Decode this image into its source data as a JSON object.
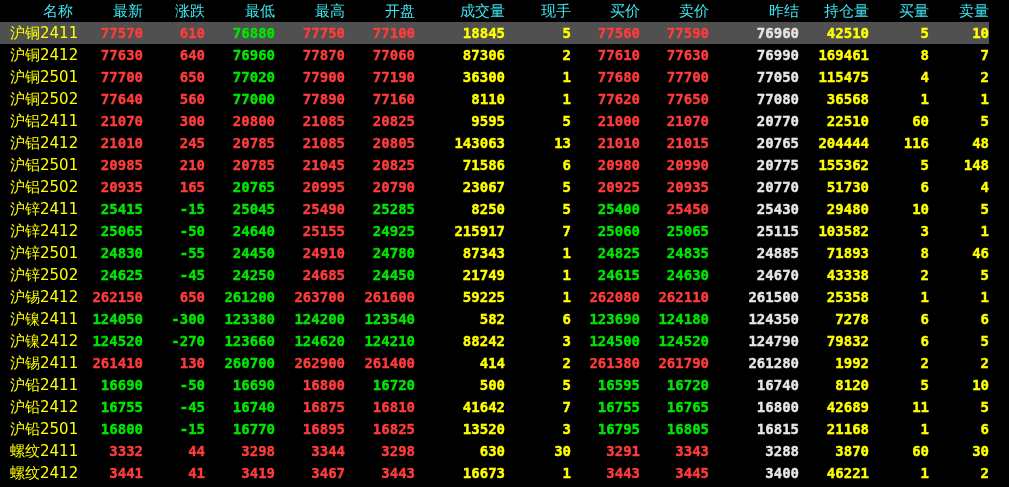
{
  "columns": [
    "名称",
    "最新",
    "涨跌",
    "最低",
    "最高",
    "开盘",
    "成交量",
    "现手",
    "买价",
    "卖价",
    "昨结",
    "持仓量",
    "买量",
    "卖量"
  ],
  "rows": [
    {
      "selected": true,
      "name": "沪铜2411",
      "cells": [
        {
          "text": "77570",
          "color": "#ff3c3c"
        },
        {
          "text": "610",
          "color": "#ff3c3c"
        },
        {
          "text": "76880",
          "color": "#00e600"
        },
        {
          "text": "77750",
          "color": "#ff3c3c"
        },
        {
          "text": "77100",
          "color": "#ff3c3c"
        },
        {
          "text": "18845"
        },
        {
          "text": "5"
        },
        {
          "text": "77560",
          "color": "#ff3c3c"
        },
        {
          "text": "77590",
          "color": "#ff3c3c"
        },
        {
          "text": "76960"
        },
        {
          "text": "42510"
        },
        {
          "text": "5"
        },
        {
          "text": "10"
        }
      ]
    },
    {
      "selected": false,
      "name": "沪铜2412",
      "cells": [
        {
          "text": "77630",
          "color": "#ff3c3c"
        },
        {
          "text": "640",
          "color": "#ff3c3c"
        },
        {
          "text": "76960",
          "color": "#00e600"
        },
        {
          "text": "77870",
          "color": "#ff3c3c"
        },
        {
          "text": "77060",
          "color": "#ff3c3c"
        },
        {
          "text": "87306"
        },
        {
          "text": "2"
        },
        {
          "text": "77610",
          "color": "#ff3c3c"
        },
        {
          "text": "77630",
          "color": "#ff3c3c"
        },
        {
          "text": "76990"
        },
        {
          "text": "169461"
        },
        {
          "text": "8"
        },
        {
          "text": "7"
        }
      ]
    },
    {
      "selected": false,
      "name": "沪铜2501",
      "cells": [
        {
          "text": "77700",
          "color": "#ff3c3c"
        },
        {
          "text": "650",
          "color": "#ff3c3c"
        },
        {
          "text": "77020",
          "color": "#00e600"
        },
        {
          "text": "77900",
          "color": "#ff3c3c"
        },
        {
          "text": "77190",
          "color": "#ff3c3c"
        },
        {
          "text": "36300"
        },
        {
          "text": "1"
        },
        {
          "text": "77680",
          "color": "#ff3c3c"
        },
        {
          "text": "77700",
          "color": "#ff3c3c"
        },
        {
          "text": "77050"
        },
        {
          "text": "115475"
        },
        {
          "text": "4"
        },
        {
          "text": "2"
        }
      ]
    },
    {
      "selected": false,
      "name": "沪铜2502",
      "cells": [
        {
          "text": "77640",
          "color": "#ff3c3c"
        },
        {
          "text": "560",
          "color": "#ff3c3c"
        },
        {
          "text": "77000",
          "color": "#00e600"
        },
        {
          "text": "77890",
          "color": "#ff3c3c"
        },
        {
          "text": "77160",
          "color": "#ff3c3c"
        },
        {
          "text": "8110"
        },
        {
          "text": "1"
        },
        {
          "text": "77620",
          "color": "#ff3c3c"
        },
        {
          "text": "77650",
          "color": "#ff3c3c"
        },
        {
          "text": "77080"
        },
        {
          "text": "36568"
        },
        {
          "text": "1"
        },
        {
          "text": "1"
        }
      ]
    },
    {
      "selected": false,
      "name": "沪铝2411",
      "cells": [
        {
          "text": "21070",
          "color": "#ff3c3c"
        },
        {
          "text": "300",
          "color": "#ff3c3c"
        },
        {
          "text": "20800",
          "color": "#ff3c3c"
        },
        {
          "text": "21085",
          "color": "#ff3c3c"
        },
        {
          "text": "20825",
          "color": "#ff3c3c"
        },
        {
          "text": "9595"
        },
        {
          "text": "5"
        },
        {
          "text": "21000",
          "color": "#ff3c3c"
        },
        {
          "text": "21070",
          "color": "#ff3c3c"
        },
        {
          "text": "20770"
        },
        {
          "text": "22510"
        },
        {
          "text": "60"
        },
        {
          "text": "5"
        }
      ]
    },
    {
      "selected": false,
      "name": "沪铝2412",
      "cells": [
        {
          "text": "21010",
          "color": "#ff3c3c"
        },
        {
          "text": "245",
          "color": "#ff3c3c"
        },
        {
          "text": "20785",
          "color": "#ff3c3c"
        },
        {
          "text": "21085",
          "color": "#ff3c3c"
        },
        {
          "text": "20805",
          "color": "#ff3c3c"
        },
        {
          "text": "143063"
        },
        {
          "text": "13"
        },
        {
          "text": "21010",
          "color": "#ff3c3c"
        },
        {
          "text": "21015",
          "color": "#ff3c3c"
        },
        {
          "text": "20765"
        },
        {
          "text": "204444"
        },
        {
          "text": "116"
        },
        {
          "text": "48"
        }
      ]
    },
    {
      "selected": false,
      "name": "沪铝2501",
      "cells": [
        {
          "text": "20985",
          "color": "#ff3c3c"
        },
        {
          "text": "210",
          "color": "#ff3c3c"
        },
        {
          "text": "20785",
          "color": "#ff3c3c"
        },
        {
          "text": "21045",
          "color": "#ff3c3c"
        },
        {
          "text": "20825",
          "color": "#ff3c3c"
        },
        {
          "text": "71586"
        },
        {
          "text": "6"
        },
        {
          "text": "20980",
          "color": "#ff3c3c"
        },
        {
          "text": "20990",
          "color": "#ff3c3c"
        },
        {
          "text": "20775"
        },
        {
          "text": "155362"
        },
        {
          "text": "5"
        },
        {
          "text": "148"
        }
      ]
    },
    {
      "selected": false,
      "name": "沪铝2502",
      "cells": [
        {
          "text": "20935",
          "color": "#ff3c3c"
        },
        {
          "text": "165",
          "color": "#ff3c3c"
        },
        {
          "text": "20765",
          "color": "#00e600"
        },
        {
          "text": "20995",
          "color": "#ff3c3c"
        },
        {
          "text": "20790",
          "color": "#ff3c3c"
        },
        {
          "text": "23067"
        },
        {
          "text": "5"
        },
        {
          "text": "20925",
          "color": "#ff3c3c"
        },
        {
          "text": "20935",
          "color": "#ff3c3c"
        },
        {
          "text": "20770"
        },
        {
          "text": "51730"
        },
        {
          "text": "6"
        },
        {
          "text": "4"
        }
      ]
    },
    {
      "selected": false,
      "name": "沪锌2411",
      "cells": [
        {
          "text": "25415",
          "color": "#00e600"
        },
        {
          "text": "-15",
          "color": "#00e600"
        },
        {
          "text": "25045",
          "color": "#00e600"
        },
        {
          "text": "25490",
          "color": "#ff3c3c"
        },
        {
          "text": "25285",
          "color": "#00e600"
        },
        {
          "text": "8250"
        },
        {
          "text": "5"
        },
        {
          "text": "25400",
          "color": "#00e600"
        },
        {
          "text": "25450",
          "color": "#ff3c3c"
        },
        {
          "text": "25430"
        },
        {
          "text": "29480"
        },
        {
          "text": "10"
        },
        {
          "text": "5"
        }
      ]
    },
    {
      "selected": false,
      "name": "沪锌2412",
      "cells": [
        {
          "text": "25065",
          "color": "#00e600"
        },
        {
          "text": "-50",
          "color": "#00e600"
        },
        {
          "text": "24640",
          "color": "#00e600"
        },
        {
          "text": "25155",
          "color": "#ff3c3c"
        },
        {
          "text": "24925",
          "color": "#00e600"
        },
        {
          "text": "215917"
        },
        {
          "text": "7"
        },
        {
          "text": "25060",
          "color": "#00e600"
        },
        {
          "text": "25065",
          "color": "#00e600"
        },
        {
          "text": "25115"
        },
        {
          "text": "103582"
        },
        {
          "text": "3"
        },
        {
          "text": "1"
        }
      ]
    },
    {
      "selected": false,
      "name": "沪锌2501",
      "cells": [
        {
          "text": "24830",
          "color": "#00e600"
        },
        {
          "text": "-55",
          "color": "#00e600"
        },
        {
          "text": "24450",
          "color": "#00e600"
        },
        {
          "text": "24910",
          "color": "#ff3c3c"
        },
        {
          "text": "24780",
          "color": "#00e600"
        },
        {
          "text": "87343"
        },
        {
          "text": "1"
        },
        {
          "text": "24825",
          "color": "#00e600"
        },
        {
          "text": "24835",
          "color": "#00e600"
        },
        {
          "text": "24885"
        },
        {
          "text": "71893"
        },
        {
          "text": "8"
        },
        {
          "text": "46"
        }
      ]
    },
    {
      "selected": false,
      "name": "沪锌2502",
      "cells": [
        {
          "text": "24625",
          "color": "#00e600"
        },
        {
          "text": "-45",
          "color": "#00e600"
        },
        {
          "text": "24250",
          "color": "#00e600"
        },
        {
          "text": "24685",
          "color": "#ff3c3c"
        },
        {
          "text": "24450",
          "color": "#00e600"
        },
        {
          "text": "21749"
        },
        {
          "text": "1"
        },
        {
          "text": "24615",
          "color": "#00e600"
        },
        {
          "text": "24630",
          "color": "#00e600"
        },
        {
          "text": "24670"
        },
        {
          "text": "43338"
        },
        {
          "text": "2"
        },
        {
          "text": "5"
        }
      ]
    },
    {
      "selected": false,
      "name": "沪锡2412",
      "cells": [
        {
          "text": "262150",
          "color": "#ff3c3c"
        },
        {
          "text": "650",
          "color": "#ff3c3c"
        },
        {
          "text": "261200",
          "color": "#00e600"
        },
        {
          "text": "263700",
          "color": "#ff3c3c"
        },
        {
          "text": "261600",
          "color": "#ff3c3c"
        },
        {
          "text": "59225"
        },
        {
          "text": "1"
        },
        {
          "text": "262080",
          "color": "#ff3c3c"
        },
        {
          "text": "262110",
          "color": "#ff3c3c"
        },
        {
          "text": "261500"
        },
        {
          "text": "25358"
        },
        {
          "text": "1"
        },
        {
          "text": "1"
        }
      ]
    },
    {
      "selected": false,
      "name": "沪镍2411",
      "cells": [
        {
          "text": "124050",
          "color": "#00e600"
        },
        {
          "text": "-300",
          "color": "#00e600"
        },
        {
          "text": "123380",
          "color": "#00e600"
        },
        {
          "text": "124200",
          "color": "#00e600"
        },
        {
          "text": "123540",
          "color": "#00e600"
        },
        {
          "text": "582"
        },
        {
          "text": "6"
        },
        {
          "text": "123690",
          "color": "#00e600"
        },
        {
          "text": "124180",
          "color": "#00e600"
        },
        {
          "text": "124350"
        },
        {
          "text": "7278"
        },
        {
          "text": "6"
        },
        {
          "text": "6"
        }
      ]
    },
    {
      "selected": false,
      "name": "沪镍2412",
      "cells": [
        {
          "text": "124520",
          "color": "#00e600"
        },
        {
          "text": "-270",
          "color": "#00e600"
        },
        {
          "text": "123660",
          "color": "#00e600"
        },
        {
          "text": "124620",
          "color": "#00e600"
        },
        {
          "text": "124210",
          "color": "#00e600"
        },
        {
          "text": "88242"
        },
        {
          "text": "3"
        },
        {
          "text": "124500",
          "color": "#00e600"
        },
        {
          "text": "124520",
          "color": "#00e600"
        },
        {
          "text": "124790"
        },
        {
          "text": "79832"
        },
        {
          "text": "6"
        },
        {
          "text": "5"
        }
      ]
    },
    {
      "selected": false,
      "name": "沪锡2411",
      "cells": [
        {
          "text": "261410",
          "color": "#ff3c3c"
        },
        {
          "text": "130",
          "color": "#ff3c3c"
        },
        {
          "text": "260700",
          "color": "#00e600"
        },
        {
          "text": "262900",
          "color": "#ff3c3c"
        },
        {
          "text": "261400",
          "color": "#ff3c3c"
        },
        {
          "text": "414"
        },
        {
          "text": "2"
        },
        {
          "text": "261380",
          "color": "#ff3c3c"
        },
        {
          "text": "261790",
          "color": "#ff3c3c"
        },
        {
          "text": "261280"
        },
        {
          "text": "1992"
        },
        {
          "text": "2"
        },
        {
          "text": "2"
        }
      ]
    },
    {
      "selected": false,
      "name": "沪铅2411",
      "cells": [
        {
          "text": "16690",
          "color": "#00e600"
        },
        {
          "text": "-50",
          "color": "#00e600"
        },
        {
          "text": "16690",
          "color": "#00e600"
        },
        {
          "text": "16800",
          "color": "#ff3c3c"
        },
        {
          "text": "16720",
          "color": "#00e600"
        },
        {
          "text": "500"
        },
        {
          "text": "5"
        },
        {
          "text": "16595",
          "color": "#00e600"
        },
        {
          "text": "16720",
          "color": "#00e600"
        },
        {
          "text": "16740"
        },
        {
          "text": "8120"
        },
        {
          "text": "5"
        },
        {
          "text": "10"
        }
      ]
    },
    {
      "selected": false,
      "name": "沪铅2412",
      "cells": [
        {
          "text": "16755",
          "color": "#00e600"
        },
        {
          "text": "-45",
          "color": "#00e600"
        },
        {
          "text": "16740",
          "color": "#00e600"
        },
        {
          "text": "16875",
          "color": "#ff3c3c"
        },
        {
          "text": "16810",
          "color": "#ff3c3c"
        },
        {
          "text": "41642"
        },
        {
          "text": "7"
        },
        {
          "text": "16755",
          "color": "#00e600"
        },
        {
          "text": "16765",
          "color": "#00e600"
        },
        {
          "text": "16800"
        },
        {
          "text": "42689"
        },
        {
          "text": "11"
        },
        {
          "text": "5"
        }
      ]
    },
    {
      "selected": false,
      "name": "沪铅2501",
      "cells": [
        {
          "text": "16800",
          "color": "#00e600"
        },
        {
          "text": "-15",
          "color": "#00e600"
        },
        {
          "text": "16770",
          "color": "#00e600"
        },
        {
          "text": "16895",
          "color": "#ff3c3c"
        },
        {
          "text": "16825",
          "color": "#ff3c3c"
        },
        {
          "text": "13520"
        },
        {
          "text": "3"
        },
        {
          "text": "16795",
          "color": "#00e600"
        },
        {
          "text": "16805",
          "color": "#00e600"
        },
        {
          "text": "16815"
        },
        {
          "text": "21168"
        },
        {
          "text": "1"
        },
        {
          "text": "6"
        }
      ]
    },
    {
      "selected": false,
      "name": "螺纹2411",
      "cells": [
        {
          "text": "3332",
          "color": "#ff3c3c"
        },
        {
          "text": "44",
          "color": "#ff3c3c"
        },
        {
          "text": "3298",
          "color": "#ff3c3c"
        },
        {
          "text": "3344",
          "color": "#ff3c3c"
        },
        {
          "text": "3298",
          "color": "#ff3c3c"
        },
        {
          "text": "630"
        },
        {
          "text": "30"
        },
        {
          "text": "3291",
          "color": "#ff3c3c"
        },
        {
          "text": "3343",
          "color": "#ff3c3c"
        },
        {
          "text": "3288"
        },
        {
          "text": "3870"
        },
        {
          "text": "60"
        },
        {
          "text": "30"
        }
      ]
    },
    {
      "selected": false,
      "name": "螺纹2412",
      "cells": [
        {
          "text": "3441",
          "color": "#ff3c3c"
        },
        {
          "text": "41",
          "color": "#ff3c3c"
        },
        {
          "text": "3419",
          "color": "#ff3c3c"
        },
        {
          "text": "3467",
          "color": "#ff3c3c"
        },
        {
          "text": "3443",
          "color": "#ff3c3c"
        },
        {
          "text": "16673"
        },
        {
          "text": "1"
        },
        {
          "text": "3443",
          "color": "#ff3c3c"
        },
        {
          "text": "3445",
          "color": "#ff3c3c"
        },
        {
          "text": "3400"
        },
        {
          "text": "46221"
        },
        {
          "text": "1"
        },
        {
          "text": "2"
        }
      ]
    }
  ]
}
